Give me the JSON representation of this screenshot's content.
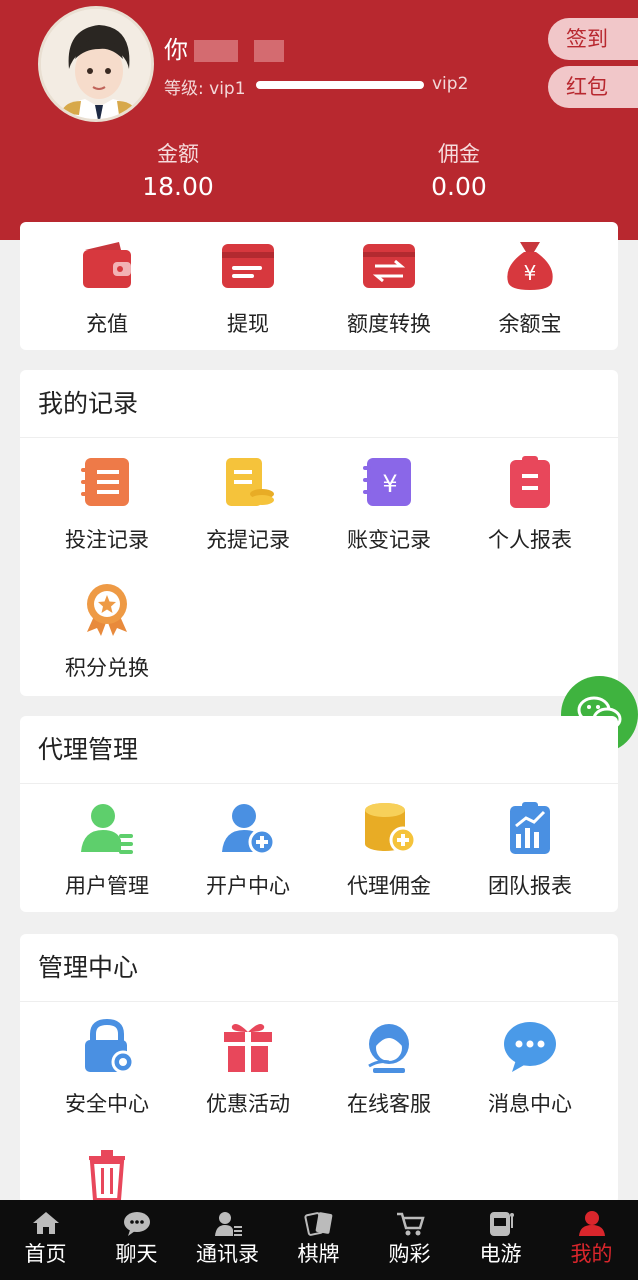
{
  "header": {
    "username": "你",
    "level_label": "等级: vip1",
    "level_next": "vip2",
    "level_progress": 1.0,
    "checkin_label": "签到",
    "redpacket_label": "红包",
    "balance_label": "金额",
    "balance_value": "18.00",
    "commission_label": "佣金",
    "commission_value": "0.00"
  },
  "quick_actions": [
    {
      "label": "充值",
      "icon": "wallet-icon"
    },
    {
      "label": "提现",
      "icon": "card-icon"
    },
    {
      "label": "额度转换",
      "icon": "transfer-icon"
    },
    {
      "label": "余额宝",
      "icon": "money-bag-icon"
    }
  ],
  "records": {
    "title": "我的记录",
    "items": [
      {
        "label": "投注记录",
        "icon": "bet-record-icon"
      },
      {
        "label": "充提记录",
        "icon": "deposit-record-icon"
      },
      {
        "label": "账变记录",
        "icon": "account-change-icon"
      },
      {
        "label": "个人报表",
        "icon": "report-icon"
      },
      {
        "label": "积分兑换",
        "icon": "medal-icon"
      }
    ]
  },
  "agent": {
    "title": "代理管理",
    "items": [
      {
        "label": "用户管理",
        "icon": "user-manage-icon"
      },
      {
        "label": "开户中心",
        "icon": "add-user-icon"
      },
      {
        "label": "代理佣金",
        "icon": "coins-icon"
      },
      {
        "label": "团队报表",
        "icon": "team-report-icon"
      }
    ]
  },
  "manage": {
    "title": "管理中心",
    "items": [
      {
        "label": "安全中心",
        "icon": "lock-icon"
      },
      {
        "label": "优惠活动",
        "icon": "gift-icon"
      },
      {
        "label": "在线客服",
        "icon": "support-icon"
      },
      {
        "label": "消息中心",
        "icon": "chat-bubble-icon"
      },
      {
        "label": "",
        "icon": "trash-icon"
      }
    ]
  },
  "tabbar": [
    {
      "label": "首页",
      "icon": "home-icon"
    },
    {
      "label": "聊天",
      "icon": "chat-icon"
    },
    {
      "label": "通讯录",
      "icon": "contacts-icon"
    },
    {
      "label": "棋牌",
      "icon": "cards-icon"
    },
    {
      "label": "购彩",
      "icon": "cart-icon"
    },
    {
      "label": "电游",
      "icon": "slot-icon"
    },
    {
      "label": "我的",
      "icon": "profile-icon",
      "active": true
    }
  ],
  "colors": {
    "brand": "#b8282f",
    "active_tab": "#d9262c",
    "wechat": "#3fb33f"
  }
}
